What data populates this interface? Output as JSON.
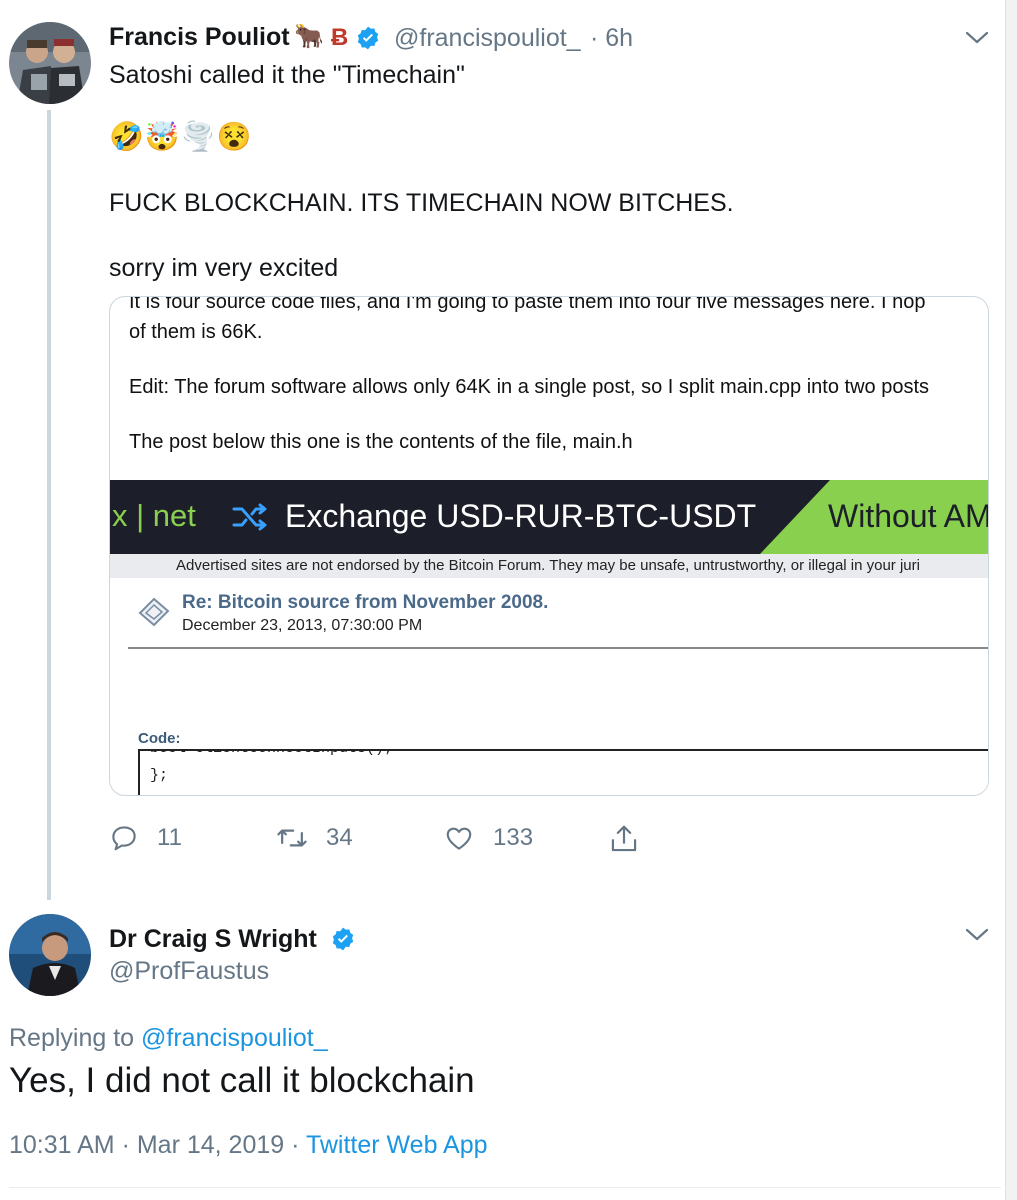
{
  "tweet1": {
    "author_name": "Francis Pouliot",
    "name_emoji": "🐂",
    "name_badge": "Ƀ",
    "handle": "@francispouliot_",
    "time": "· 6h",
    "text_line1": "Satoshi called it the \"Timechain\"",
    "emojis": "🤣🤯🌪️😵",
    "text_line2": "FUCK BLOCKCHAIN. ITS TIMECHAIN NOW BITCHES.",
    "text_line3": "sorry im very excited",
    "embed": {
      "line_clipped": "It is four source code files, and I'm going to paste them into four five messages here.  I hop",
      "line1": "of them is 66K.",
      "line2": "Edit:  The forum software allows only 64K in a single post, so I split main.cpp into two posts",
      "line3": "The post below this one is the contents of the file, main.h",
      "banner_logo": "x | net",
      "banner_text": "Exchange USD-RUR-BTC-USDT",
      "banner_cta": "Without AM",
      "ad_note": "Advertised sites are not endorsed by the Bitcoin Forum. They may be unsafe, untrustworthy, or illegal in your juri",
      "post_title": "Re: Bitcoin source from November 2008.",
      "post_date": "December 23, 2013, 07:30:00 PM",
      "code_label": "Code:",
      "code_line1": "    bool ClientConnectInputs();",
      "code_line2": "};"
    },
    "replies": "11",
    "retweets": "34",
    "likes": "133"
  },
  "tweet2": {
    "author_name": "Dr Craig S Wright",
    "handle": "@ProfFaustus",
    "replying_prefix": "Replying to ",
    "replying_handle": "@francispouliot_",
    "text": "Yes, I did not call it blockchain",
    "time": "10:31 AM",
    "date": "Mar 14, 2019",
    "source": "Twitter Web App"
  },
  "colors": {
    "link": "#1b95e0",
    "muted": "#657786",
    "verified": "#1da1f2",
    "forum_link": "#4b6a8a",
    "banner_green": "#8ad04f"
  }
}
